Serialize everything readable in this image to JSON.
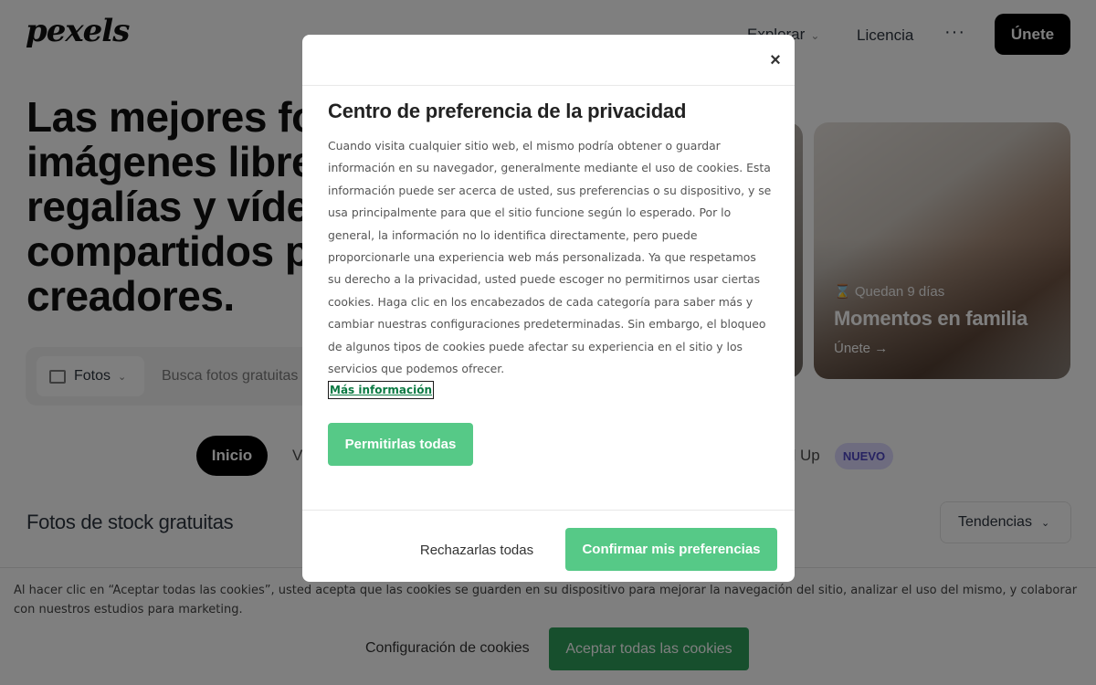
{
  "header": {
    "logo": "pexels",
    "nav_explore": "Explorar",
    "nav_license": "Licencia",
    "nav_more": "···",
    "join": "Únete"
  },
  "hero": {
    "title": "Las mejores fotos gratis, imágenes libres de regalías y vídeos compartidos por creadores.",
    "search_type": "Fotos",
    "search_placeholder": "Busca fotos gratuitas"
  },
  "promo": {
    "days_left": "Quedan 9 días",
    "title": "Momentos en familia",
    "cta": "Únete →"
  },
  "tabs": {
    "home": "Inicio",
    "videos_partial": "V",
    "levelup_partial": "el Up",
    "new_badge": "NUEVO"
  },
  "section": {
    "title": "Fotos de stock gratuitas",
    "sort": "Tendencias"
  },
  "cookie_banner": {
    "text": "Al hacer clic en “Aceptar todas las cookies”, usted acepta que las cookies se guarden en su dispositivo para mejorar la navegación del sitio, analizar el uso del mismo, y colaborar con nuestros estudios para marketing.",
    "config_link": "Configuración de cookies",
    "accept_all": "Aceptar todas las cookies"
  },
  "modal": {
    "close": "×",
    "title": "Centro de preferencia de la privacidad",
    "body": "Cuando visita cualquier sitio web, el mismo podría obtener o guardar información en su navegador, generalmente mediante el uso de cookies. Esta información puede ser acerca de usted, sus preferencias o su dispositivo, y se usa principalmente para que el sitio funcione según lo esperado. Por lo general, la información no lo identifica directamente, pero puede proporcionarle una experiencia web más personalizada. Ya que respetamos su derecho a la privacidad, usted puede escoger no permitirnos usar ciertas cookies. Haga clic en los encabezados de cada categoría para saber más y cambiar nuestras configuraciones predeterminadas. Sin embargo, el bloqueo de algunos tipos de cookies puede afectar su experiencia en el sitio y los servicios que podemos ofrecer.",
    "more_info": "Más información",
    "allow_all": "Permitirlas todas",
    "reject_all": "Rechazarlas todas",
    "confirm": "Confirmar mis preferencias"
  },
  "colors": {
    "accent_green": "#56c987",
    "banner_green": "#2e9e5b",
    "badge_bg": "#dcd9ff",
    "badge_text": "#4f46c4"
  }
}
